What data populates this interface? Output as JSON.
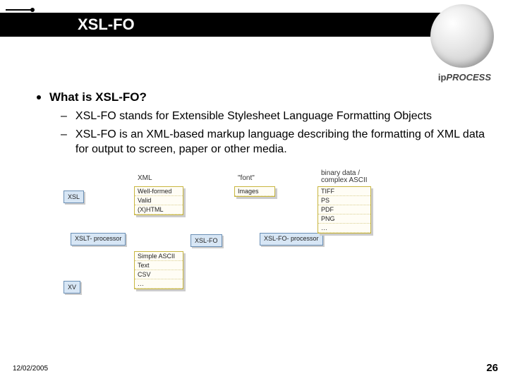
{
  "title": "XSL-FO",
  "logo_text": "ipPROCESS",
  "heading": "What is XSL-FO?",
  "bullets": [
    "XSL-FO stands for Extensible Stylesheet Language Formatting Objects",
    "XSL-FO is an XML-based markup language describing the formatting of XML data for output to screen, paper or other media."
  ],
  "diagram": {
    "xsl": "XSL",
    "xslt": "XSLT-\nprocessor",
    "xv": "XV",
    "xslfo": "XSL-FO",
    "xslfoproc": "XSL-FO-\nprocessor",
    "columns": [
      {
        "title": "XML",
        "items": [
          "Well-formed",
          "Valid",
          "(X)HTML"
        ]
      },
      {
        "title": "",
        "items": [
          "Simple ASCII",
          "Text",
          "CSV",
          "…"
        ]
      },
      {
        "title": "\"font\"",
        "items": [
          "Images"
        ]
      },
      {
        "title": "binary data /\ncomplex ASCII",
        "items": [
          "TIFF",
          "PS",
          "PDF",
          "PNG",
          "…"
        ]
      }
    ]
  },
  "footer": {
    "date": "12/02/2005",
    "page": "26"
  }
}
